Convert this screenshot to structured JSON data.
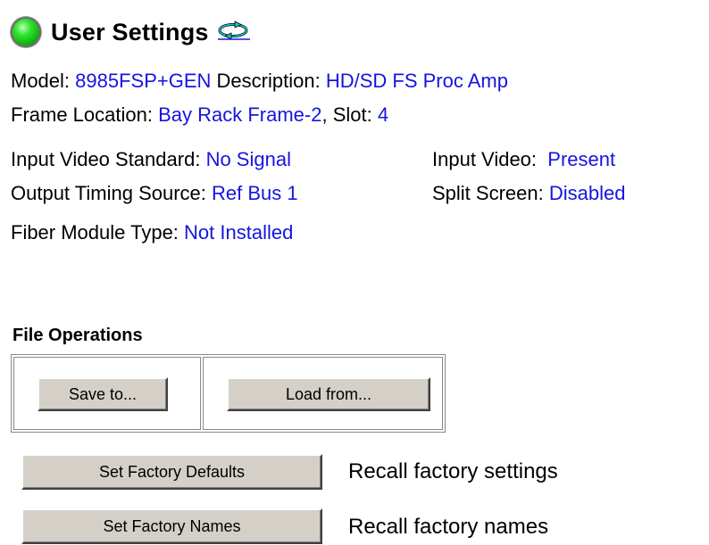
{
  "header": {
    "title": "User Settings",
    "status_icon": "green-status-led",
    "refresh_icon": "refresh-icon"
  },
  "info": {
    "model_label": "Model:",
    "model_value": "8985FSP+GEN",
    "description_label": "Description:",
    "description_value": "HD/SD FS Proc Amp",
    "frame_location_label": "Frame Location:",
    "frame_location_value": "Bay Rack Frame-2",
    "slot_label": ", Slot:",
    "slot_value": "4",
    "input_video_standard_label": "Input Video Standard:",
    "input_video_standard_value": "No Signal",
    "input_video_label": "Input Video:",
    "input_video_value": "Present",
    "output_timing_source_label": "Output Timing Source:",
    "output_timing_source_value": "Ref Bus 1",
    "split_screen_label": "Split Screen:",
    "split_screen_value": "Disabled",
    "fiber_module_type_label": "Fiber Module Type:",
    "fiber_module_type_value": "Not Installed"
  },
  "file_operations": {
    "title": "File Operations",
    "save_label": "Save to...",
    "load_label": "Load from..."
  },
  "factory": {
    "defaults_button": "Set Factory Defaults",
    "defaults_description": "Recall factory settings",
    "names_button": "Set Factory Names",
    "names_description": "Recall factory names"
  },
  "colors": {
    "value_text": "#1515e0",
    "status_led": "#19c219",
    "button_face": "#d4d0c8"
  }
}
